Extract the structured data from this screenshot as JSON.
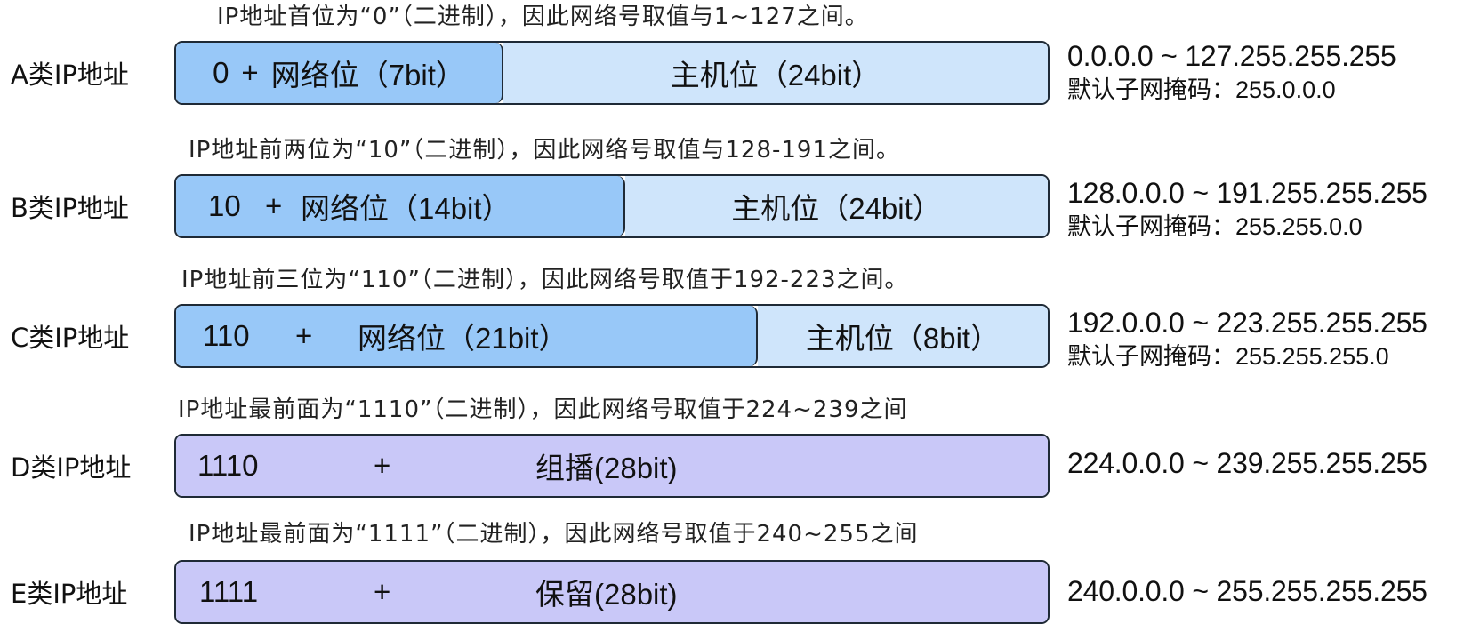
{
  "rows": [
    {
      "caption": "IP地址首位为“0”（二进制），因此网络号取值与1~127之间。",
      "label": "A类IP地址",
      "network_prefix": "0",
      "plus": "+",
      "network_text": "网络位（7bit）",
      "host_text": "主机位（24bit）",
      "range": "0.0.0.0 ~ 127.255.255.255",
      "mask": "默认子网掩码：255.0.0.0"
    },
    {
      "caption": "IP地址前两位为“10”（二进制），因此网络号取值与128-191之间。",
      "label": "B类IP地址",
      "network_prefix": "10",
      "plus": "+",
      "network_text": "网络位（14bit）",
      "host_text": "主机位（24bit）",
      "range": "128.0.0.0 ~ 191.255.255.255",
      "mask": "默认子网掩码：255.255.0.0"
    },
    {
      "caption": "IP地址前三位为“110”（二进制），因此网络号取值于192-223之间。",
      "label": "C类IP地址",
      "network_prefix": "110",
      "plus": "+",
      "network_text": "网络位（21bit）",
      "host_text": "主机位（8bit）",
      "range": "192.0.0.0 ~ 223.255.255.255",
      "mask": "默认子网掩码：255.255.255.0"
    },
    {
      "caption": "IP地址最前面为“1110”（二进制），因此网络号取值于224~239之间",
      "label": "D类IP地址",
      "prefix": "1110",
      "plus": "+",
      "text": "组播(28bit)",
      "range": "224.0.0.0 ~ 239.255.255.255"
    },
    {
      "caption": "IP地址最前面为“1111”（二进制），因此网络号取值于240~255之间",
      "label": "E类IP地址",
      "prefix": "1111",
      "plus": "+",
      "text": "保留(28bit)",
      "range": "240.0.0.0 ~ 255.255.255.255"
    }
  ],
  "colors": {
    "network": "#98c8f8",
    "host": "#cfe5fb",
    "multicast_reserved": "#c9c8f8",
    "border": "#1f2a36"
  }
}
